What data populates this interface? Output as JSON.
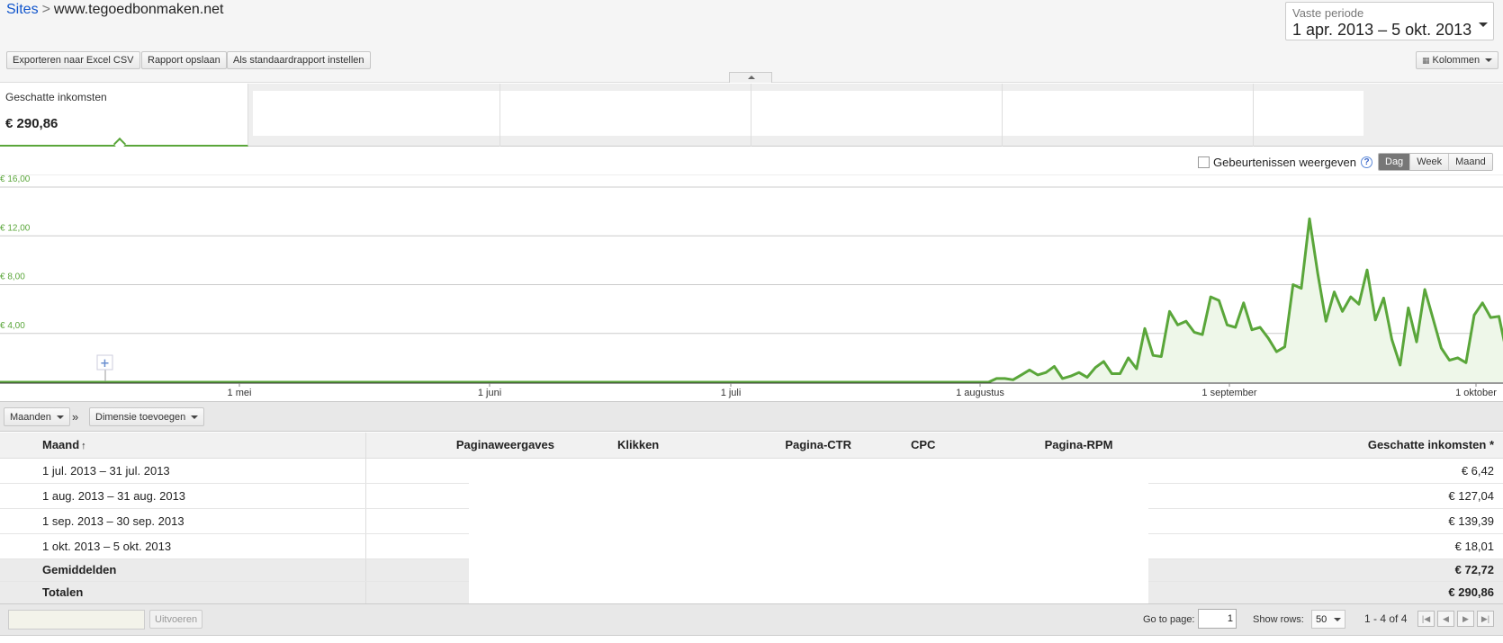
{
  "breadcrumb": {
    "root": "Sites",
    "separator": ">",
    "site": "www.tegoedbonmaken.net"
  },
  "period": {
    "label": "Vaste periode",
    "value": "1 apr. 2013 – 5 okt. 2013"
  },
  "toolbar": {
    "export": "Exporteren naar Excel CSV",
    "save": "Rapport opslaan",
    "default": "Als standaardrapport instellen",
    "columns": "Kolommen"
  },
  "scorecard": {
    "label": "Geschatte inkomsten",
    "value": "€ 290,86"
  },
  "graph_controls": {
    "events_label": "Gebeurtenissen weergeven",
    "help": "?",
    "granularity": [
      "Dag",
      "Week",
      "Maand"
    ],
    "selected": "Dag"
  },
  "chart_data": {
    "type": "area",
    "series": [
      {
        "name": "Geschatte inkomsten",
        "color": "#5aa63a"
      }
    ],
    "x_tick_labels": [
      "1 mei",
      "1 juni",
      "1 juli",
      "1 augustus",
      "1 september",
      "1 oktober"
    ],
    "y_tick_labels": [
      "€ 4,00",
      "€ 8,00",
      "€ 12,00",
      "€ 16,00"
    ],
    "ylim": [
      0,
      16
    ],
    "grid": true,
    "x": [
      "2013-08-01",
      "2013-08-02",
      "2013-08-03",
      "2013-08-04",
      "2013-08-05",
      "2013-08-06",
      "2013-08-07",
      "2013-08-08",
      "2013-08-09",
      "2013-08-10",
      "2013-08-11",
      "2013-08-12",
      "2013-08-13",
      "2013-08-14",
      "2013-08-15",
      "2013-08-16",
      "2013-08-17",
      "2013-08-18",
      "2013-08-19",
      "2013-08-20",
      "2013-08-21",
      "2013-08-22",
      "2013-08-23",
      "2013-08-24",
      "2013-08-25",
      "2013-08-26",
      "2013-08-27",
      "2013-08-28",
      "2013-08-29",
      "2013-08-30",
      "2013-08-31",
      "2013-09-01",
      "2013-09-02",
      "2013-09-03",
      "2013-09-04",
      "2013-09-05",
      "2013-09-06",
      "2013-09-07",
      "2013-09-08",
      "2013-09-09",
      "2013-09-10",
      "2013-09-11",
      "2013-09-12",
      "2013-09-13",
      "2013-09-14",
      "2013-09-15",
      "2013-09-16",
      "2013-09-17",
      "2013-09-18",
      "2013-09-19",
      "2013-09-20",
      "2013-09-21",
      "2013-09-22",
      "2013-09-23",
      "2013-09-24",
      "2013-09-25",
      "2013-09-26",
      "2013-09-27",
      "2013-09-28",
      "2013-09-29",
      "2013-09-30",
      "2013-10-01",
      "2013-10-02",
      "2013-10-03",
      "2013-10-04",
      "2013-10-05"
    ],
    "values": [
      0.3,
      0.3,
      0.2,
      0.6,
      1.0,
      0.6,
      0.8,
      1.3,
      0.3,
      0.5,
      0.8,
      0.4,
      1.2,
      1.7,
      0.7,
      0.7,
      2.0,
      1.1,
      4.4,
      2.2,
      2.1,
      5.8,
      4.7,
      5.0,
      4.1,
      3.9,
      7.0,
      6.7,
      4.7,
      4.5,
      6.5,
      4.3,
      4.5,
      3.6,
      2.5,
      2.9,
      8.0,
      7.7,
      13.4,
      8.9,
      5.0,
      7.4,
      5.8,
      7.0,
      6.4,
      9.2,
      5.1,
      6.9,
      3.5,
      1.4,
      6.1,
      3.3,
      7.6,
      5.2,
      2.8,
      1.8,
      2.0,
      1.6,
      5.5,
      6.5,
      5.3,
      5.4,
      2.2,
      2.3,
      2.3,
      5.6
    ]
  },
  "table_controls": {
    "dimension": "Maanden",
    "raquo": "»",
    "add_dimension": "Dimensie toevoegen"
  },
  "table": {
    "headers": [
      "Maand",
      "Paginaweergaves",
      "Klikken",
      "Pagina-CTR",
      "CPC",
      "Pagina-RPM",
      "Geschatte inkomsten *"
    ],
    "sort_arrow": "↑",
    "rows": [
      {
        "month": "1 jul. 2013 – 31 jul. 2013",
        "income": "€ 6,42"
      },
      {
        "month": "1 aug. 2013 – 31 aug. 2013",
        "income": "€ 127,04"
      },
      {
        "month": "1 sep. 2013 – 30 sep. 2013",
        "income": "€ 139,39"
      },
      {
        "month": "1 okt. 2013 – 5 okt. 2013",
        "income": "€ 18,01"
      }
    ],
    "averages": {
      "label": "Gemiddelden",
      "income": "€ 72,72"
    },
    "totals": {
      "label": "Totalen",
      "income": "€ 290,86"
    }
  },
  "footer": {
    "run": "Uitvoeren",
    "goto_label": "Go to page:",
    "page": "1",
    "show_rows_label": "Show rows:",
    "rows": "50",
    "range": "1 - 4 of 4"
  }
}
